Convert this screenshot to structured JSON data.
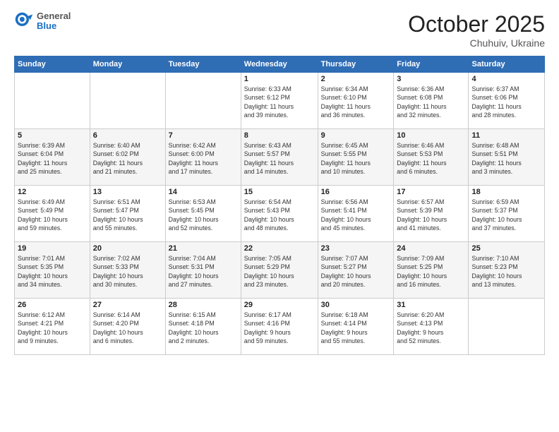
{
  "header": {
    "logo": {
      "general": "General",
      "blue": "Blue"
    },
    "title": "October 2025",
    "subtitle": "Chuhuiv, Ukraine"
  },
  "calendar": {
    "weekdays": [
      "Sunday",
      "Monday",
      "Tuesday",
      "Wednesday",
      "Thursday",
      "Friday",
      "Saturday"
    ],
    "weeks": [
      [
        {
          "day": "",
          "info": ""
        },
        {
          "day": "",
          "info": ""
        },
        {
          "day": "",
          "info": ""
        },
        {
          "day": "1",
          "info": "Sunrise: 6:33 AM\nSunset: 6:12 PM\nDaylight: 11 hours\nand 39 minutes."
        },
        {
          "day": "2",
          "info": "Sunrise: 6:34 AM\nSunset: 6:10 PM\nDaylight: 11 hours\nand 36 minutes."
        },
        {
          "day": "3",
          "info": "Sunrise: 6:36 AM\nSunset: 6:08 PM\nDaylight: 11 hours\nand 32 minutes."
        },
        {
          "day": "4",
          "info": "Sunrise: 6:37 AM\nSunset: 6:06 PM\nDaylight: 11 hours\nand 28 minutes."
        }
      ],
      [
        {
          "day": "5",
          "info": "Sunrise: 6:39 AM\nSunset: 6:04 PM\nDaylight: 11 hours\nand 25 minutes."
        },
        {
          "day": "6",
          "info": "Sunrise: 6:40 AM\nSunset: 6:02 PM\nDaylight: 11 hours\nand 21 minutes."
        },
        {
          "day": "7",
          "info": "Sunrise: 6:42 AM\nSunset: 6:00 PM\nDaylight: 11 hours\nand 17 minutes."
        },
        {
          "day": "8",
          "info": "Sunrise: 6:43 AM\nSunset: 5:57 PM\nDaylight: 11 hours\nand 14 minutes."
        },
        {
          "day": "9",
          "info": "Sunrise: 6:45 AM\nSunset: 5:55 PM\nDaylight: 11 hours\nand 10 minutes."
        },
        {
          "day": "10",
          "info": "Sunrise: 6:46 AM\nSunset: 5:53 PM\nDaylight: 11 hours\nand 6 minutes."
        },
        {
          "day": "11",
          "info": "Sunrise: 6:48 AM\nSunset: 5:51 PM\nDaylight: 11 hours\nand 3 minutes."
        }
      ],
      [
        {
          "day": "12",
          "info": "Sunrise: 6:49 AM\nSunset: 5:49 PM\nDaylight: 10 hours\nand 59 minutes."
        },
        {
          "day": "13",
          "info": "Sunrise: 6:51 AM\nSunset: 5:47 PM\nDaylight: 10 hours\nand 55 minutes."
        },
        {
          "day": "14",
          "info": "Sunrise: 6:53 AM\nSunset: 5:45 PM\nDaylight: 10 hours\nand 52 minutes."
        },
        {
          "day": "15",
          "info": "Sunrise: 6:54 AM\nSunset: 5:43 PM\nDaylight: 10 hours\nand 48 minutes."
        },
        {
          "day": "16",
          "info": "Sunrise: 6:56 AM\nSunset: 5:41 PM\nDaylight: 10 hours\nand 45 minutes."
        },
        {
          "day": "17",
          "info": "Sunrise: 6:57 AM\nSunset: 5:39 PM\nDaylight: 10 hours\nand 41 minutes."
        },
        {
          "day": "18",
          "info": "Sunrise: 6:59 AM\nSunset: 5:37 PM\nDaylight: 10 hours\nand 37 minutes."
        }
      ],
      [
        {
          "day": "19",
          "info": "Sunrise: 7:01 AM\nSunset: 5:35 PM\nDaylight: 10 hours\nand 34 minutes."
        },
        {
          "day": "20",
          "info": "Sunrise: 7:02 AM\nSunset: 5:33 PM\nDaylight: 10 hours\nand 30 minutes."
        },
        {
          "day": "21",
          "info": "Sunrise: 7:04 AM\nSunset: 5:31 PM\nDaylight: 10 hours\nand 27 minutes."
        },
        {
          "day": "22",
          "info": "Sunrise: 7:05 AM\nSunset: 5:29 PM\nDaylight: 10 hours\nand 23 minutes."
        },
        {
          "day": "23",
          "info": "Sunrise: 7:07 AM\nSunset: 5:27 PM\nDaylight: 10 hours\nand 20 minutes."
        },
        {
          "day": "24",
          "info": "Sunrise: 7:09 AM\nSunset: 5:25 PM\nDaylight: 10 hours\nand 16 minutes."
        },
        {
          "day": "25",
          "info": "Sunrise: 7:10 AM\nSunset: 5:23 PM\nDaylight: 10 hours\nand 13 minutes."
        }
      ],
      [
        {
          "day": "26",
          "info": "Sunrise: 6:12 AM\nSunset: 4:21 PM\nDaylight: 10 hours\nand 9 minutes."
        },
        {
          "day": "27",
          "info": "Sunrise: 6:14 AM\nSunset: 4:20 PM\nDaylight: 10 hours\nand 6 minutes."
        },
        {
          "day": "28",
          "info": "Sunrise: 6:15 AM\nSunset: 4:18 PM\nDaylight: 10 hours\nand 2 minutes."
        },
        {
          "day": "29",
          "info": "Sunrise: 6:17 AM\nSunset: 4:16 PM\nDaylight: 9 hours\nand 59 minutes."
        },
        {
          "day": "30",
          "info": "Sunrise: 6:18 AM\nSunset: 4:14 PM\nDaylight: 9 hours\nand 55 minutes."
        },
        {
          "day": "31",
          "info": "Sunrise: 6:20 AM\nSunset: 4:13 PM\nDaylight: 9 hours\nand 52 minutes."
        },
        {
          "day": "",
          "info": ""
        }
      ]
    ]
  }
}
